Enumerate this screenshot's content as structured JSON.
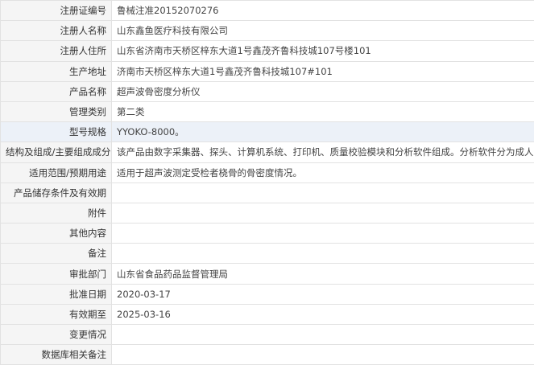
{
  "colors": {
    "label_bg": "#f5f5f5",
    "value_bg": "#ffffff",
    "border": "#e2e2e2",
    "highlight_row_bg": "#ecf1f8",
    "text": "#333333"
  },
  "rows": [
    {
      "label": "注册证编号",
      "value": "鲁械注准20152070276"
    },
    {
      "label": "注册人名称",
      "value": "山东鑫鱼医疗科技有限公司"
    },
    {
      "label": "注册人住所",
      "value": "山东省济南市天桥区梓东大道1号鑫茂齐鲁科技城107号楼101"
    },
    {
      "label": "生产地址",
      "value": "济南市天桥区梓东大道1号鑫茂齐鲁科技城107#101"
    },
    {
      "label": "产品名称",
      "value": "超声波骨密度分析仪"
    },
    {
      "label": "管理类别",
      "value": "第二类"
    },
    {
      "label": "型号规格",
      "value": "YYOKO-8000。"
    },
    {
      "label": "结构及组成/主要组成成分",
      "value": "该产品由数字采集器、探头、计算机系统、打印机、质量校验模块和分析软件组成。分析软件分为成人与儿童。"
    },
    {
      "label": "适用范围/预期用途",
      "value": "适用于超声波测定受检者桡骨的骨密度情况。"
    },
    {
      "label": "产品储存条件及有效期",
      "value": ""
    },
    {
      "label": "附件",
      "value": ""
    },
    {
      "label": "其他内容",
      "value": ""
    },
    {
      "label": "备注",
      "value": ""
    },
    {
      "label": "审批部门",
      "value": "山东省食品药品监督管理局"
    },
    {
      "label": "批准日期",
      "value": "2020-03-17"
    },
    {
      "label": "有效期至",
      "value": "2025-03-16"
    },
    {
      "label": "变更情况",
      "value": ""
    },
    {
      "label": "数据库相关备注",
      "value": ""
    }
  ]
}
